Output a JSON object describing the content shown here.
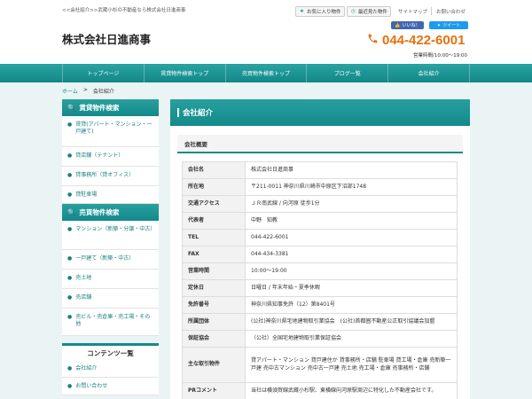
{
  "header": {
    "tagline": "<<会社紹介>>武蔵小杉の不動産なら株式会社日進商事",
    "favorites_label": "お気に入り物件",
    "recent_label": "最近見た物件",
    "sitemap_label": "サイトマップ",
    "contact_label": "お問い合わせ",
    "logo": "株式会社日進商事",
    "like_label": "いいね！",
    "tweet_label": "ツイート",
    "phone": "044-422-6001",
    "hours": "営業時間/10:00～19:00"
  },
  "nav": [
    "トップページ",
    "賃貸物件検索トップ",
    "売買物件検索トップ",
    "ブログ一覧",
    "会社紹介"
  ],
  "breadcrumb": {
    "home": "ホーム",
    "separator": ">",
    "current": "会社紹介"
  },
  "sidebar": {
    "rent_title": "賃貸物件検索",
    "rent_items": [
      "賃貸(アパート・マンション・一戸建て)",
      "貸店舗（テナント）",
      "貸事務所（貸オフィス）",
      "貸駐車場"
    ],
    "sale_title": "売買物件検索",
    "sale_items": [
      "マンション（新築・分譲・中古）",
      "一戸建て（新築・中古）",
      "売土地",
      "売店舗",
      "売ビル・売倉庫・売工場・その他"
    ],
    "contents_title": "コンテンツ一覧",
    "contents_items": [
      "会社紹介",
      "お問い合わせ"
    ]
  },
  "main": {
    "title": "会社紹介",
    "section_title": "会社概要",
    "rows": [
      {
        "label": "会社名",
        "value": "株式会社日進商事"
      },
      {
        "label": "所在地",
        "value": "〒211-0011 神奈川県川崎市中原区下沼部1748"
      },
      {
        "label": "交通アクセス",
        "value": "ＪＲ南武線 / 向河原 徒歩1分"
      },
      {
        "label": "代表者",
        "value": "中野　知教"
      },
      {
        "label": "TEL",
        "value": "044-422-6001"
      },
      {
        "label": "FAX",
        "value": "044-434-3381"
      },
      {
        "label": "営業時間",
        "value": "10:00～19:00"
      },
      {
        "label": "定休日",
        "value": "日曜日 / 年末年始・夏季休暇"
      },
      {
        "label": "免許番号",
        "value": "神奈川県知事免許（12）第8401号"
      },
      {
        "label": "所属団体",
        "value": "(公社)神奈川県宅地建物取引業協会　(公社)首都圏不動産公正取引協議会加盟"
      },
      {
        "label": "保証協会",
        "value": "（公社）全国宅地建物取引業保証協会"
      },
      {
        "label": "主な取引物件",
        "value": "貸アパート・マンション 貸戸建住か 貸事務所・店舗 駐車場 貸工場・倉庫 売新築一戸建 売中古マンション 売中古一戸建 売土地 売工場・倉庫 売事務所・店舗"
      },
      {
        "label": "PRコメント",
        "value": "当社は横須賀線武蔵小杉駅、東横線向河原駅周辺に特化した不動産会社です。"
      }
    ]
  },
  "colors": {
    "teal": "#19898a",
    "orange": "#e8700d",
    "bg": "#eaf4f4"
  }
}
